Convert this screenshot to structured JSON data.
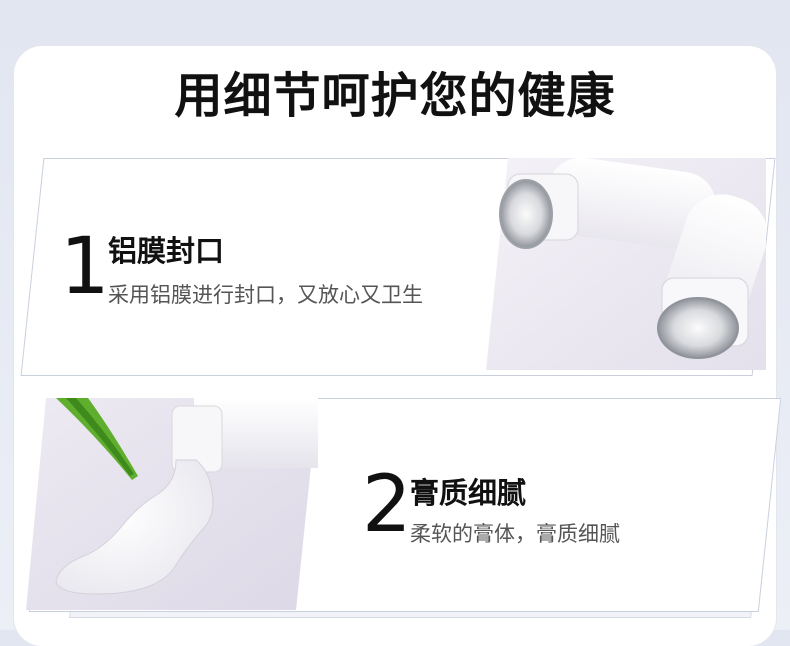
{
  "header": {
    "title": "用细节呵护您的健康"
  },
  "features": [
    {
      "number": "1",
      "heading": "铝膜封口",
      "description": "采用铝膜进行封口，又放心又卫生"
    },
    {
      "number": "2",
      "heading": "膏质细腻",
      "description": "柔软的膏体，膏质细腻"
    }
  ],
  "colors": {
    "background": "#e6e9f2",
    "card": "#ffffff",
    "panel_border": "#c9d0dd",
    "text": "#111111",
    "muted_text": "#555555",
    "leaf_green": "#5fae2e"
  }
}
